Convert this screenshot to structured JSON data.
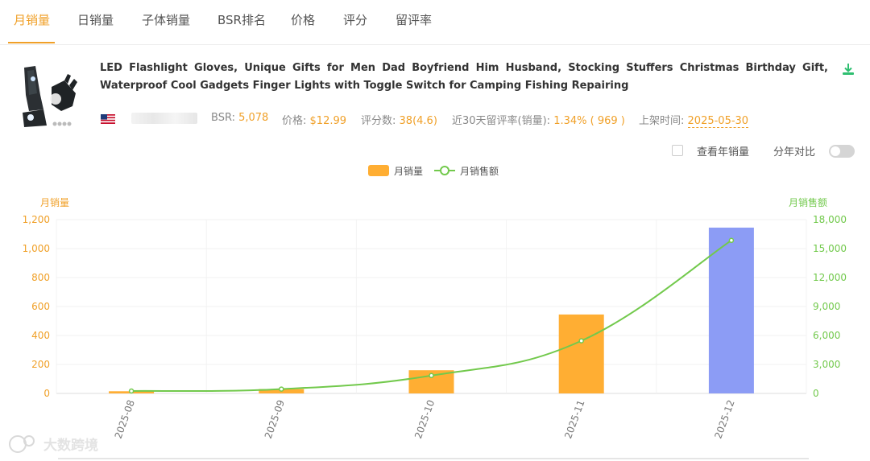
{
  "tabs": [
    {
      "label": "月销量",
      "active": true
    },
    {
      "label": "日销量"
    },
    {
      "label": "子体销量"
    },
    {
      "label": "BSR排名"
    },
    {
      "label": "价格"
    },
    {
      "label": "评分"
    },
    {
      "label": "留评率"
    }
  ],
  "product": {
    "title": "LED Flashlight Gloves, Unique Gifts for Men Dad Boyfriend Him Husband, Stocking Stuffers Christmas Birthday Gift, Waterproof Cool Gadgets Finger Lights with Toggle Switch for Camping Fishing Repairing",
    "bsr_label": "BSR:",
    "bsr_value": "5,078",
    "price_label": "价格:",
    "price_value": "$12.99",
    "rating_label": "评分数:",
    "rating_value": "38(4.6)",
    "review_rate_label": "近30天留评率(销量):",
    "review_rate_value": "1.34% ( 969 )",
    "listed_label": "上架时间:",
    "listed_value": "2025-05-30"
  },
  "options": {
    "year_sales_label": "查看年销量",
    "year_compare_label": "分年对比"
  },
  "colors": {
    "accent": "#f0a028",
    "bar": "#ffae33",
    "bar_highlight": "#8c9cf5",
    "line": "#72c94c"
  },
  "chart_data": {
    "type": "bar",
    "categories": [
      "2025-08",
      "2025-09",
      "2025-10",
      "2025-11",
      "2025-12"
    ],
    "series": [
      {
        "name": "月销量",
        "type": "bar",
        "axis": "left",
        "values": [
          15,
          30,
          160,
          545,
          1145
        ]
      },
      {
        "name": "月销售额",
        "type": "line",
        "axis": "right",
        "values": [
          250,
          450,
          1850,
          5450,
          15850
        ]
      }
    ],
    "ylabel_left": "月销量",
    "ylabel_right": "月销售额",
    "ylim_left": [
      0,
      1200
    ],
    "ylim_right": [
      0,
      18000
    ],
    "yticks_left": [
      "0",
      "200",
      "400",
      "600",
      "800",
      "1,000",
      "1,200"
    ],
    "yticks_right": [
      "0",
      "3,000",
      "6,000",
      "9,000",
      "12,000",
      "15,000",
      "18,000"
    ],
    "legend_position": "top-center",
    "grid": true
  }
}
